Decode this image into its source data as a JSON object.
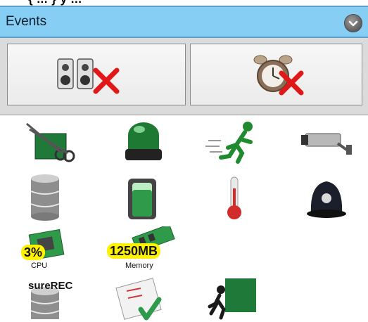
{
  "top_clipped_text": "{ ... } y ...",
  "header": {
    "title": "Events",
    "collapse_icon": "chevron-down-circle-icon"
  },
  "actions": {
    "left_icon": "speakers-x-icon",
    "right_icon": "alarm-clock-x-icon"
  },
  "grid": [
    {
      "icon": "video-edit-icon"
    },
    {
      "icon": "green-beacon-icon"
    },
    {
      "icon": "running-person-icon"
    },
    {
      "icon": "security-camera-icon"
    },
    {
      "icon": "database-icon"
    },
    {
      "icon": "battery-icon"
    },
    {
      "icon": "thermometer-icon"
    },
    {
      "icon": "police-helmet-icon"
    },
    {
      "icon": "cpu-chip-icon",
      "badge": "3%",
      "caption": "CPU"
    },
    {
      "icon": "memory-module-icon",
      "badge": "1250MB",
      "caption": "Memory"
    },
    {
      "icon": "surerec-database-icon",
      "label": "sureREC"
    },
    {
      "icon": "checklist-icon"
    },
    {
      "icon": "exit-door-runner-icon"
    }
  ],
  "colors": {
    "header_bg": "#87cef4",
    "green": "#1f7a3a",
    "red": "#e01818"
  }
}
